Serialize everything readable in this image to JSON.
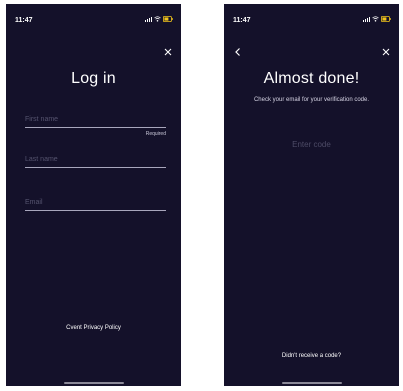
{
  "login_screen": {
    "status_time": "11:47",
    "title": "Log in",
    "fields": {
      "first_name_placeholder": "First name",
      "required_note": "Required",
      "last_name_placeholder": "Last name",
      "email_placeholder": "Email"
    },
    "footer_link": "Cvent Privacy Policy"
  },
  "verify_screen": {
    "status_time": "11:47",
    "title": "Almost done!",
    "subtitle": "Check your email for your verification code.",
    "code_placeholder": "Enter code",
    "footer_link": "Didn't receive a code?"
  },
  "colors": {
    "background": "#14112a",
    "text": "#ffffff",
    "placeholder": "#55536e",
    "field_line": "#a8a6bc"
  },
  "icons": [
    "signal-icon",
    "wifi-icon",
    "battery-icon",
    "close-icon",
    "back-icon"
  ]
}
